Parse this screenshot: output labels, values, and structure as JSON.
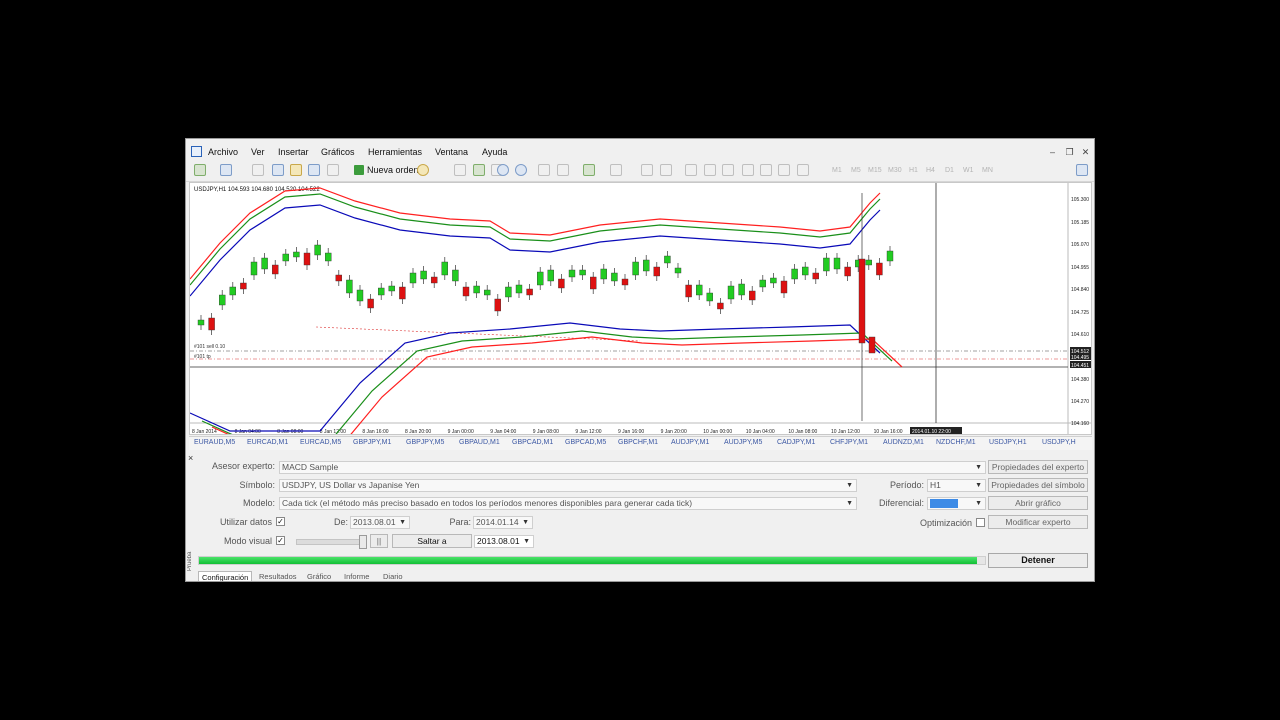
{
  "menu": [
    "Archivo",
    "Ver",
    "Insertar",
    "Gráficos",
    "Herramientas",
    "Ventana",
    "Ayuda"
  ],
  "toolbar": {
    "new_order": "Nueva orden",
    "timeframes": [
      "M1",
      "M5",
      "M15",
      "M30",
      "H1",
      "H4",
      "D1",
      "W1",
      "MN"
    ]
  },
  "chart": {
    "header": "USDJPY,H1  104.593 104.680 104.520 104.522",
    "price_axis": [
      "105.300",
      "105.185",
      "105.070",
      "104.955",
      "104.840",
      "104.725",
      "104.610",
      "104.512",
      "104.495",
      "104.451",
      "104.380",
      "104.270",
      "104.160"
    ],
    "time_axis": [
      "8 Jan 2014",
      "8 Jan 04:00",
      "8 Jan 08:00",
      "8 Jan 12:00",
      "8 Jan 16:00",
      "8 Jan 20:00",
      "9 Jan 00:00",
      "9 Jan 04:00",
      "9 Jan 08:00",
      "9 Jan 12:00",
      "9 Jan 16:00",
      "9 Jan 20:00",
      "10 Jan 00:00",
      "10 Jan 04:00",
      "10 Jan 08:00",
      "10 Jan 12:00",
      "10 Jan 16:00"
    ],
    "crosshair_time": "2014.01.10 22:00",
    "line_labels": [
      "#101 sell 0.10",
      "#101 tp"
    ],
    "colors": {
      "bull": "#22cc22",
      "bear": "#dd1111",
      "upper_band": "#ff2020",
      "mid_band": "#1a8f1a",
      "inner_band": "#0a0ab8"
    }
  },
  "chart_tabs": [
    "EURAUD,M5",
    "EURCAD,M1",
    "EURCAD,M5",
    "GBPJPY,M1",
    "GBPJPY,M5",
    "GBPAUD,M1",
    "GBPCAD,M1",
    "GBPCAD,M5",
    "GBPCHF,M1",
    "AUDJPY,M1",
    "AUDJPY,M5",
    "CADJPY,M1",
    "CHFJPY,M1",
    "AUDNZD,M1",
    "NZDCHF,M1",
    "USDJPY,H1",
    "USDJPY,H"
  ],
  "tester": {
    "side_label": "Prueba",
    "expert_label": "Asesor experto:",
    "expert_value": "MACD Sample",
    "symbol_label": "Símbolo:",
    "symbol_value": "USDJPY, US Dollar vs Japanise Yen",
    "model_label": "Modelo:",
    "model_value": "Cada tick (el método más preciso basado en todos los períodos menores disponibles para generar cada tick)",
    "use_dates_label": "Utilizar datos",
    "from_label": "De:",
    "from_value": "2013.08.01",
    "to_label": "Para:",
    "to_value": "2014.01.14",
    "visual_label": "Modo visual",
    "pause": "||",
    "skip_to": "Saltar a",
    "skip_value": "2013.08.01",
    "period_label": "Período:",
    "period_value": "H1",
    "spread_label": "Diferencial:",
    "optimization_label": "Optimización",
    "btn_expert_props": "Propiedades del experto",
    "btn_symbol_props": "Propiedades del símbolo",
    "btn_open_chart": "Abrir gráfico",
    "btn_modify_expert": "Modificar experto",
    "btn_stop": "Detener",
    "progress": 0.99,
    "tabs": [
      "Configuración",
      "Resultados",
      "Gráfico",
      "Informe",
      "Diario"
    ]
  }
}
